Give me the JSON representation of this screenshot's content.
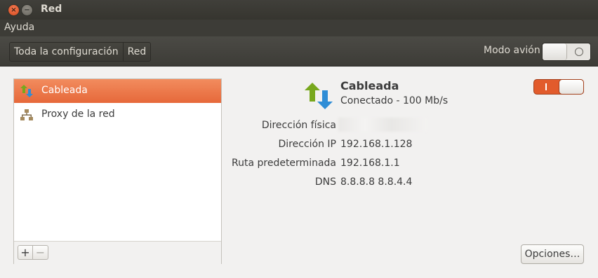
{
  "window": {
    "title": "Red",
    "close_glyph": "×",
    "minimize_glyph": "−"
  },
  "menubar": {
    "items": [
      "Ayuda"
    ]
  },
  "toolbar": {
    "breadcrumbs": [
      "Toda la configuración",
      "Red"
    ],
    "airplane_mode_label": "Modo avión",
    "airplane_mode_on": false
  },
  "devices": {
    "items": [
      {
        "label": "Cableada",
        "icon": "wired-network-icon",
        "selected": true
      },
      {
        "label": "Proxy de la red",
        "icon": "network-proxy-icon",
        "selected": false
      }
    ],
    "add_label": "+",
    "remove_label": "−"
  },
  "connection": {
    "name": "Cableada",
    "status": "Conectado - 100 Mb/s",
    "enabled": true,
    "details": [
      {
        "label": "Dirección física",
        "value": ""
      },
      {
        "label": "Dirección IP",
        "value": "192.168.1.128"
      },
      {
        "label": "Ruta predeterminada",
        "value": "192.168.1.1"
      },
      {
        "label": "DNS",
        "value": "8.8.8.8 8.8.4.4"
      }
    ],
    "options_label": "Opciones…"
  },
  "colors": {
    "accent": "#e6683a",
    "arrow_up": "#78a81d",
    "arrow_down": "#2f8dd6"
  }
}
